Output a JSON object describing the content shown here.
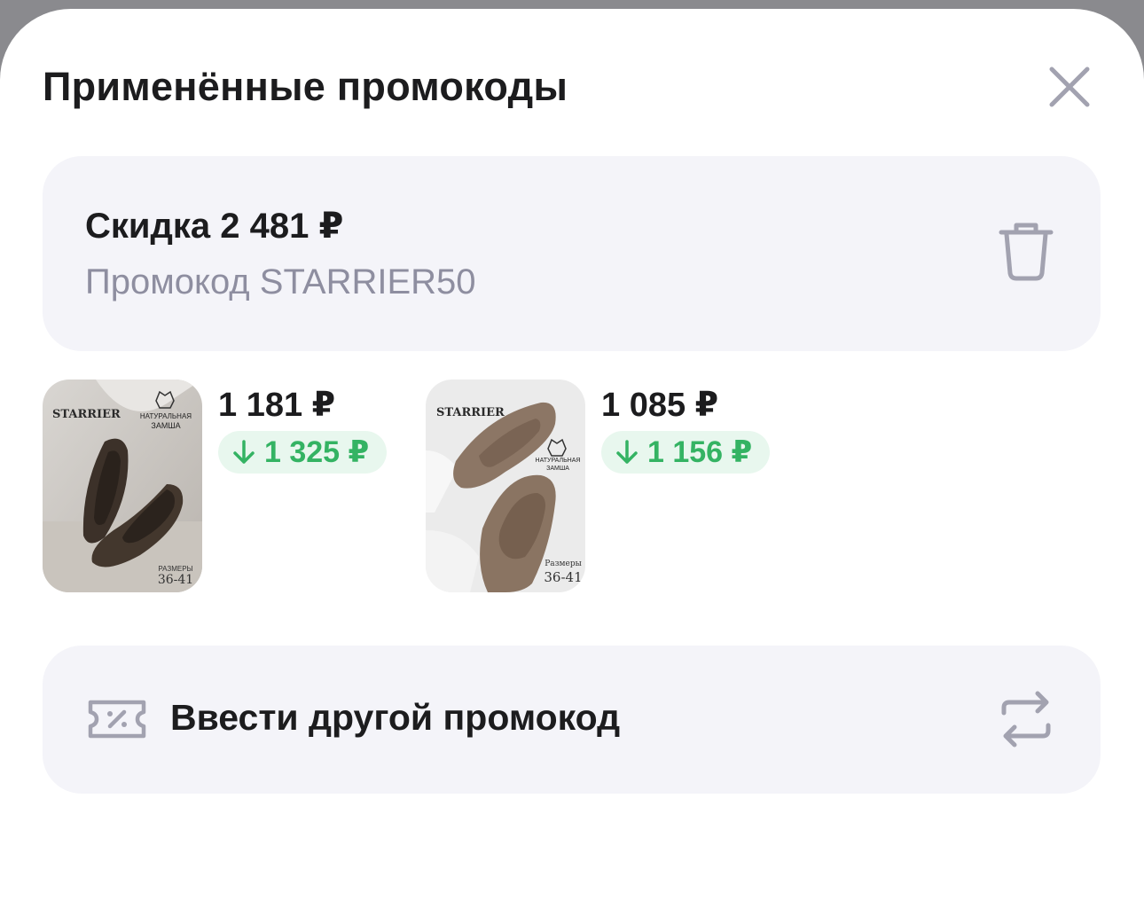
{
  "sheet": {
    "title": "Применённые промокоды",
    "close_icon": "close-icon"
  },
  "promo": {
    "discount": "Скидка 2 481 ₽",
    "code_line": "Промокод STARRIER50",
    "delete_icon": "trash-icon"
  },
  "products": [
    {
      "price": "1 181 ₽",
      "old_price": "1 325 ₽",
      "image": {
        "brand": "STARRIER",
        "badge_line1": "НАТУРАЛЬНАЯ",
        "badge_line2": "ЗАМША",
        "sizes_label": "РАЗМЕРЫ",
        "sizes": "36-41"
      }
    },
    {
      "price": "1 085 ₽",
      "old_price": "1 156 ₽",
      "image": {
        "brand": "STARRIER",
        "badge_line1": "НАТУРАЛЬНАЯ",
        "badge_line2": "ЗАМША",
        "sizes_label": "Размеры",
        "sizes": "36-41"
      }
    }
  ],
  "enter_other": {
    "label": "Ввести другой промокод",
    "icon": "promo-ticket-icon",
    "action_icon": "swap-arrows-icon"
  },
  "colors": {
    "card_bg": "#f4f4f9",
    "discount_green": "#34b363",
    "discount_green_bg": "#e8f7ee",
    "muted_text": "#8e8ea0"
  }
}
